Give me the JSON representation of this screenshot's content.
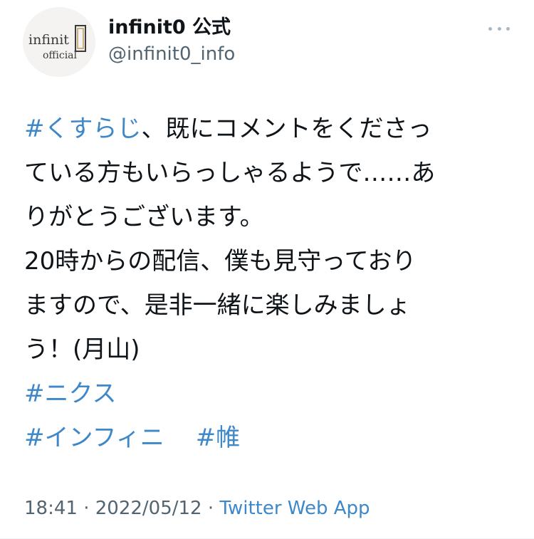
{
  "author": {
    "display_name": "infinit0 公式",
    "handle": "@infinit0_info",
    "avatar_logo_text": "infinit0 official"
  },
  "tweet": {
    "line1": {
      "hashtag": "#くすらじ",
      "text": "、既にコメントをくださっ"
    },
    "line2": "ている方もいらっしゃるようで……あ",
    "line3": "りがとうございます。",
    "line4": "20時からの配信、僕も見守っており",
    "line5": "ますので、是非一緒に楽しみましょ",
    "line6": "う！(月山)",
    "hashtags": [
      "#ニクス",
      "#インフィニ",
      "#帷"
    ]
  },
  "meta": {
    "time": "18:41",
    "separator": " · ",
    "date": "2022/05/12",
    "source": "Twitter Web App"
  },
  "colors": {
    "hashtag": "#3e88c9",
    "text": "#0f1419",
    "muted": "#536471"
  }
}
